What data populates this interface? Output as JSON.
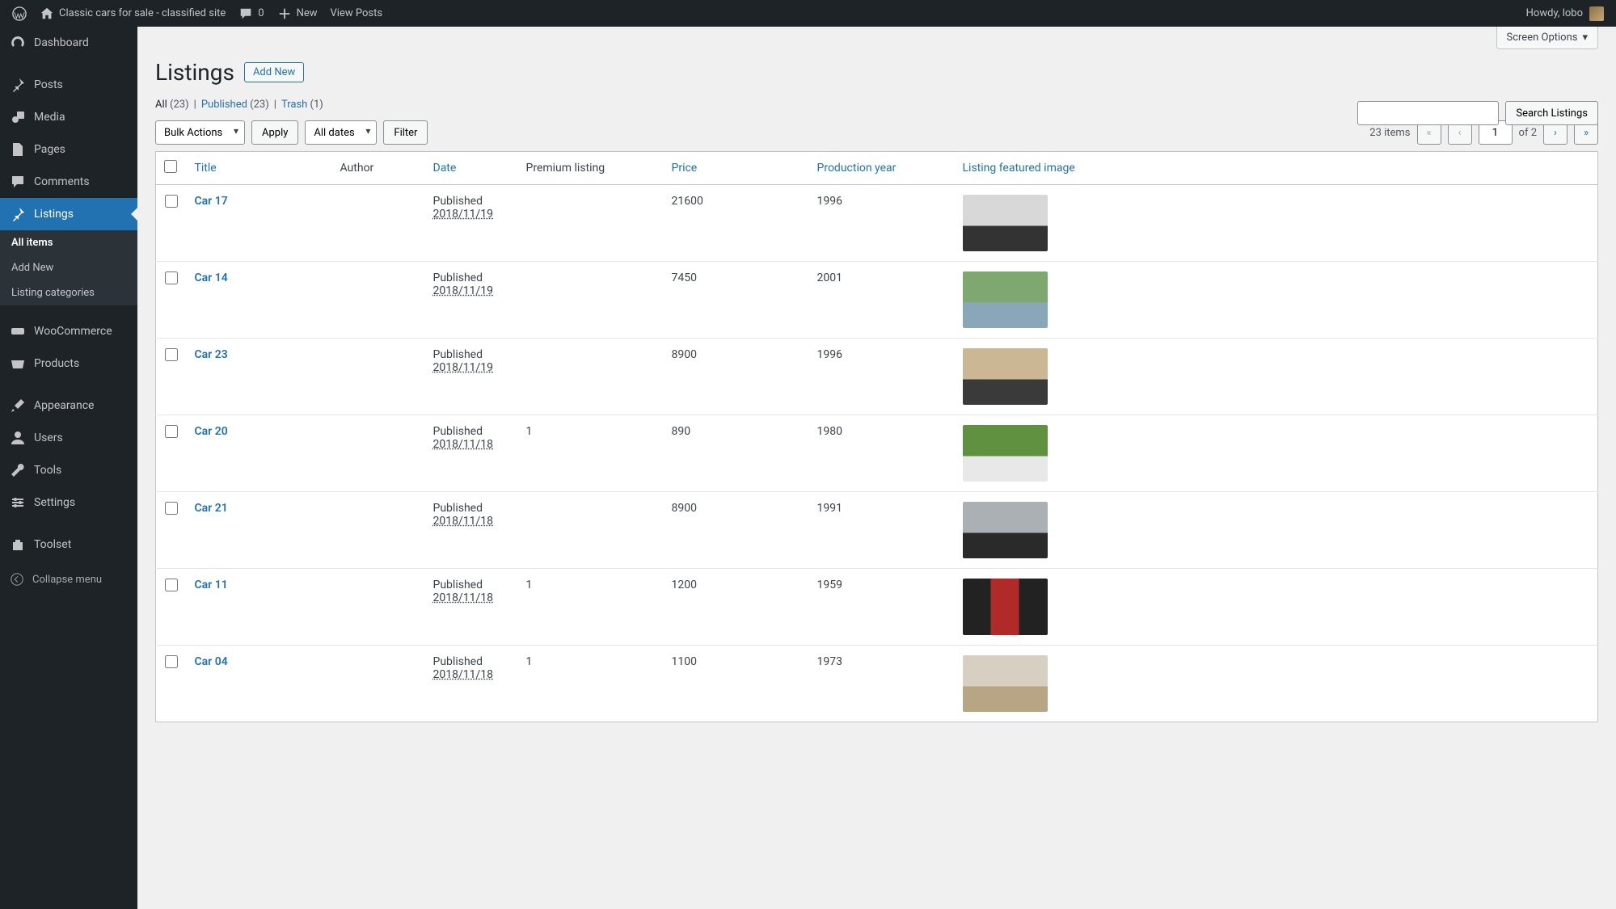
{
  "adminbar": {
    "site_title": "Classic cars for sale - classified site",
    "comments_count": "0",
    "new_label": "New",
    "view_posts_label": "View Posts",
    "howdy": "Howdy, lobo"
  },
  "sidebar": {
    "items": [
      {
        "label": "Dashboard"
      },
      {
        "label": "Posts"
      },
      {
        "label": "Media"
      },
      {
        "label": "Pages"
      },
      {
        "label": "Comments"
      },
      {
        "label": "Listings"
      },
      {
        "label": "WooCommerce"
      },
      {
        "label": "Products"
      },
      {
        "label": "Appearance"
      },
      {
        "label": "Users"
      },
      {
        "label": "Tools"
      },
      {
        "label": "Settings"
      },
      {
        "label": "Toolset"
      }
    ],
    "submenu": [
      {
        "label": "All items"
      },
      {
        "label": "Add New"
      },
      {
        "label": "Listing categories"
      }
    ],
    "collapse": "Collapse menu"
  },
  "screen_options": "Screen Options",
  "page_heading": "Listings",
  "add_new_button": "Add New",
  "filters": {
    "all_label": "All",
    "all_count": "(23)",
    "published_label": "Published",
    "published_count": "(23)",
    "trash_label": "Trash",
    "trash_count": "(1)"
  },
  "bulk_actions": {
    "select": "Bulk Actions",
    "apply": "Apply",
    "dates": "All dates",
    "filter": "Filter"
  },
  "search": {
    "button": "Search Listings"
  },
  "pagination": {
    "items_label": "23 items",
    "current_page": "1",
    "of_label": "of 2"
  },
  "columns": {
    "title": "Title",
    "author": "Author",
    "date": "Date",
    "premium": "Premium listing",
    "price": "Price",
    "year": "Production year",
    "image": "Listing featured image"
  },
  "rows": [
    {
      "title": "Car 17",
      "status": "Published",
      "date": "2018/11/19",
      "premium": "",
      "price": "21600",
      "year": "1996"
    },
    {
      "title": "Car 14",
      "status": "Published",
      "date": "2018/11/19",
      "premium": "",
      "price": "7450",
      "year": "2001"
    },
    {
      "title": "Car 23",
      "status": "Published",
      "date": "2018/11/19",
      "premium": "",
      "price": "8900",
      "year": "1996"
    },
    {
      "title": "Car 20",
      "status": "Published",
      "date": "2018/11/18",
      "premium": "1",
      "price": "890",
      "year": "1980"
    },
    {
      "title": "Car 21",
      "status": "Published",
      "date": "2018/11/18",
      "premium": "",
      "price": "8900",
      "year": "1991"
    },
    {
      "title": "Car 11",
      "status": "Published",
      "date": "2018/11/18",
      "premium": "1",
      "price": "1200",
      "year": "1959"
    },
    {
      "title": "Car 04",
      "status": "Published",
      "date": "2018/11/18",
      "premium": "1",
      "price": "1100",
      "year": "1973"
    }
  ]
}
